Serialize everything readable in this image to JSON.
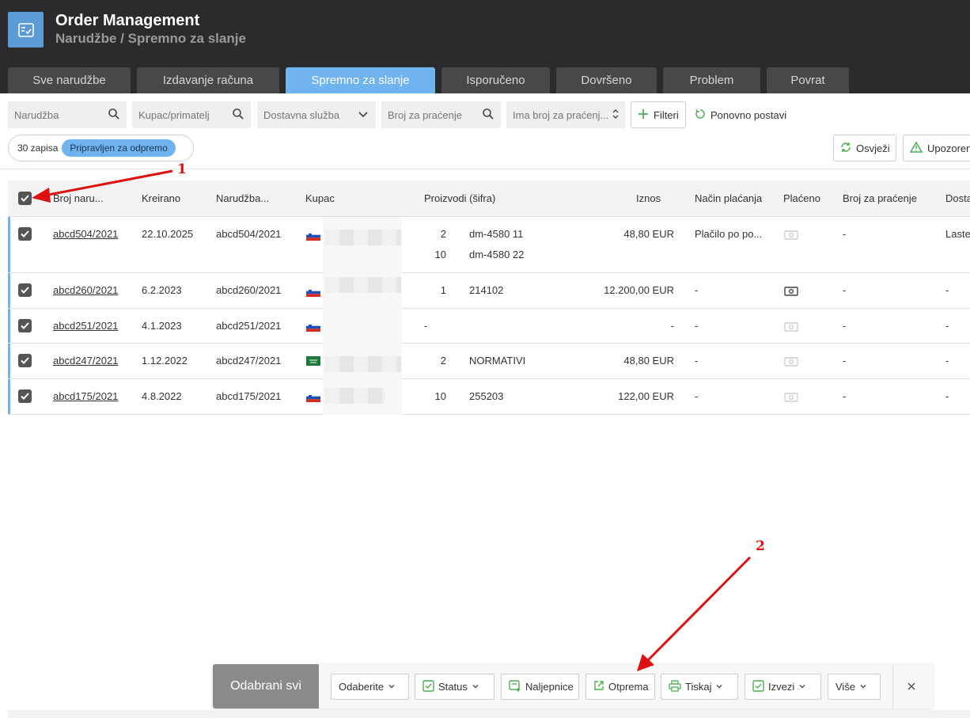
{
  "app": {
    "title": "Order Management",
    "breadcrumb": "Narudžbe / Spremno za slanje"
  },
  "tabs": [
    {
      "label": "Sve narudžbe",
      "active": false
    },
    {
      "label": "Izdavanje računa",
      "active": false
    },
    {
      "label": "Spremno za slanje",
      "active": true
    },
    {
      "label": "Isporučeno",
      "active": false
    },
    {
      "label": "Dovršeno",
      "active": false
    },
    {
      "label": "Problem",
      "active": false
    },
    {
      "label": "Povrat",
      "active": false
    }
  ],
  "filters": {
    "order_placeholder": "Narudžba",
    "customer_placeholder": "Kupac/primatelj",
    "delivery_service": "Dostavna služba",
    "tracking_placeholder": "Broj za praćenje",
    "has_tracking": "Ima broj za praćenj...",
    "filters_button": "Filteri",
    "reset_button": "Ponovno postavi"
  },
  "summary": {
    "count": "30 zapisa",
    "status": "Pripravljen za odpremo"
  },
  "toolbar": {
    "refresh": "Osvježi",
    "warnings": "Upozoren"
  },
  "table": {
    "headers": {
      "order_no": "Broj naru...",
      "created": "Kreirano",
      "order_ref": "Narudžba...",
      "customer": "Kupac",
      "products": "Proizvodi (šifra)",
      "amount": "Iznos",
      "payment": "Način plaćanja",
      "paid": "Plaćeno",
      "tracking": "Broj za praćenje",
      "delivery": "Dosta"
    },
    "rows": [
      {
        "order_no": "abcd504/2021",
        "created": "22.10.2025",
        "order_ref": "abcd504/2021",
        "flag": "si",
        "qty1": "2",
        "code1": "dm-4580 11",
        "qty2": "10",
        "code2": "dm-4580 22",
        "amount": "48,80 EUR",
        "payment": "Plačilo po po...",
        "paid": false,
        "tracking": "-",
        "delivery": "Laste"
      },
      {
        "order_no": "abcd260/2021",
        "created": "6.2.2023",
        "order_ref": "abcd260/2021",
        "flag": "si",
        "qty1": "1",
        "code1": "214102",
        "amount": "12.200,00 EUR",
        "payment": "-",
        "paid": true,
        "tracking": "-",
        "delivery": "-"
      },
      {
        "order_no": "abcd251/2021",
        "created": "4.1.2023",
        "order_ref": "abcd251/2021",
        "flag": "si",
        "qty1": "-",
        "code1": "",
        "amount": "-",
        "payment": "-",
        "paid": false,
        "tracking": "-",
        "delivery": "-"
      },
      {
        "order_no": "abcd247/2021",
        "created": "1.12.2022",
        "order_ref": "abcd247/2021",
        "flag": "sa",
        "qty1": "2",
        "code1": "NORMATIVI",
        "amount": "48,80 EUR",
        "payment": "-",
        "paid": false,
        "tracking": "-",
        "delivery": "-"
      },
      {
        "order_no": "abcd175/2021",
        "created": "4.8.2022",
        "order_ref": "abcd175/2021",
        "flag": "si",
        "qty1": "10",
        "code1": "255203",
        "amount": "122,00 EUR",
        "payment": "-",
        "paid": false,
        "tracking": "-",
        "delivery": "-"
      }
    ]
  },
  "action_bar": {
    "selected_all": "Odabrani svi",
    "choose": "Odaberite",
    "status": "Status",
    "labels": "Naljepnice",
    "dispatch": "Otprema",
    "print": "Tiskaj",
    "reports": "Izvezi",
    "more": "Više"
  },
  "annotations": {
    "one": "1",
    "two": "2"
  },
  "colors": {
    "accent": "#6fb3ef",
    "header_bg": "#2b2b2e",
    "green_icon": "#4caf50",
    "arrow_red": "#d11111"
  }
}
